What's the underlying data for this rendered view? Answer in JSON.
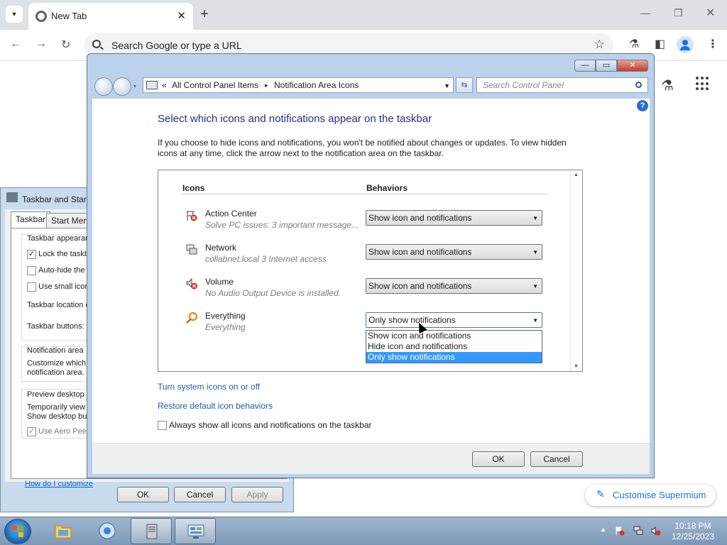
{
  "browser": {
    "tab_title": "New Tab",
    "omnibox_placeholder": "Search Google or type a URL",
    "customise_label": "Customise Supermium"
  },
  "taskbar_props": {
    "title": "Taskbar and Start",
    "tabs": [
      "Taskbar",
      "Start Menu"
    ],
    "group1_title": "Taskbar appearan",
    "lock": "Lock the taskb",
    "autohide": "Auto-hide the",
    "small_icons": "Use small icons",
    "location": "Taskbar location o",
    "buttons": "Taskbar buttons:",
    "notif_title": "Notification area",
    "notif_desc1": "Customize which i",
    "notif_desc2": "notification area.",
    "preview_title": "Preview desktop v",
    "preview_desc1": "Temporarily view",
    "preview_desc2": "Show desktop but",
    "aero_peek": "Use Aero Peek",
    "help_link": "How do I customize",
    "ok": "OK",
    "cancel": "Cancel",
    "apply": "Apply"
  },
  "control_panel": {
    "breadcrumb_prefix": "«",
    "breadcrumb_1": "All Control Panel Items",
    "breadcrumb_sep": "▸",
    "breadcrumb_2": "Notification Area Icons",
    "search_placeholder": "Search Control Panel",
    "heading": "Select which icons and notifications appear on the taskbar",
    "description": "If you choose to hide icons and notifications, you won't be notified about changes or updates. To view hidden icons at any time, click the arrow next to the notification area on the taskbar.",
    "col_icons": "Icons",
    "col_behaviors": "Behaviors",
    "rows": [
      {
        "name": "Action Center",
        "sub": "Solve PC issues: 3 important message...",
        "behavior": "Show icon and notifications"
      },
      {
        "name": "Network",
        "sub": "collabnet.local  3 Internet access",
        "behavior": "Show icon and notifications"
      },
      {
        "name": "Volume",
        "sub": "No Audio Output Device is installed.",
        "behavior": "Show icon and notifications"
      },
      {
        "name": "Everything",
        "sub": "Everything",
        "behavior": "Only show notifications"
      }
    ],
    "dropdown_options": [
      "Show icon and notifications",
      "Hide icon and notifications",
      "Only show notifications"
    ],
    "dropdown_selected_index": 2,
    "link_system_icons": "Turn system icons on or off",
    "link_restore": "Restore default icon behaviors",
    "always_show": "Always show all icons and notifications on the taskbar",
    "ok": "OK",
    "cancel": "Cancel"
  },
  "os_taskbar": {
    "time": "10:18 PM",
    "date": "12/25/2023"
  }
}
